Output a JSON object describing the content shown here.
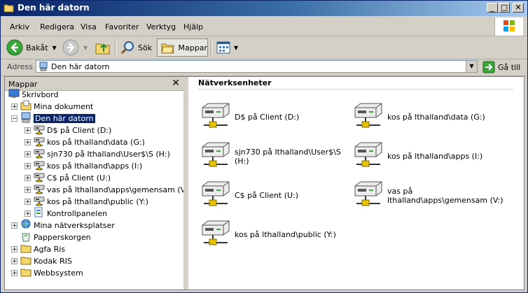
{
  "window": {
    "title": "Den här datorn",
    "buttons": {
      "minimize": "_",
      "maximize": "□",
      "close": "✕"
    }
  },
  "menu": [
    "Arkiv",
    "Redigera",
    "Visa",
    "Favoriter",
    "Verktyg",
    "Hjälp"
  ],
  "toolbar": {
    "back": "Bakåt",
    "search": "Sök",
    "folders": "Mappar"
  },
  "address": {
    "label": "Adress",
    "value": "Den här datorn",
    "go": "Gå till"
  },
  "folderpane": {
    "title": "Mappar",
    "close": "✕"
  },
  "tree": [
    {
      "label": "Skrivbord",
      "expander": "",
      "icon": "desktop-icon"
    },
    {
      "label": "Mina dokument",
      "expander": "+",
      "icon": "my-documents-icon"
    },
    {
      "label": "Den här datorn",
      "expander": "−",
      "icon": "my-computer-icon",
      "selected": true
    },
    {
      "label": "D$ på Client (D:)",
      "expander": "+",
      "icon": "network-drive-icon"
    },
    {
      "label": "kos på lthalland\\data (G:)",
      "expander": "+",
      "icon": "network-drive-icon"
    },
    {
      "label": "sjn730 på lthalland\\User$\\S (H:)",
      "expander": "+",
      "icon": "network-drive-icon"
    },
    {
      "label": "kos på lthalland\\apps (I:)",
      "expander": "+",
      "icon": "network-drive-icon"
    },
    {
      "label": "C$ på Client (U:)",
      "expander": "+",
      "icon": "network-drive-icon"
    },
    {
      "label": "vas på lthalland\\apps\\gemensam (V:)",
      "expander": "+",
      "icon": "network-drive-icon"
    },
    {
      "label": "kos på lthalland\\public (Y:)",
      "expander": "+",
      "icon": "network-drive-icon"
    },
    {
      "label": "Kontrollpanelen",
      "expander": "+",
      "icon": "control-panel-icon"
    },
    {
      "label": "Mina nätverksplatser",
      "expander": "+",
      "icon": "network-places-icon"
    },
    {
      "label": "Papperskorgen",
      "expander": "",
      "icon": "recycle-bin-icon"
    },
    {
      "label": "Agfa Ris",
      "expander": "+",
      "icon": "folder-icon"
    },
    {
      "label": "Kodak RIS",
      "expander": "+",
      "icon": "folder-icon"
    },
    {
      "label": "Webbsystem",
      "expander": "+",
      "icon": "folder-icon"
    }
  ],
  "main": {
    "group_title": "Nätverksenheter",
    "drives": [
      {
        "label": "D$ på Client (D:)"
      },
      {
        "label": "kos på lthalland\\data (G:)"
      },
      {
        "label": "sjn730 på lthalland\\User$\\S (H:)"
      },
      {
        "label": "kos på lthalland\\apps (I:)"
      },
      {
        "label": "C$ på Client (U:)"
      },
      {
        "label": "vas på lthalland\\apps\\gemensam (V:)"
      },
      {
        "label": "kos på lthalland\\public (Y:)"
      }
    ]
  },
  "colors": {
    "title_blue": "#0a246a",
    "selection": "#0a246a",
    "face": "#d4d0c8"
  }
}
